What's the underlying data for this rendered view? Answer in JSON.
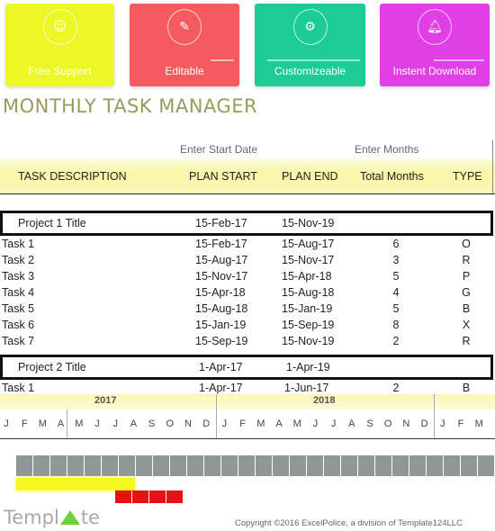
{
  "feature_cards": [
    {
      "label": "Free Support",
      "icon": "support-icon",
      "color": "#eef726"
    },
    {
      "label": "Editable",
      "icon": "edit-icon",
      "color": "#f55a5e"
    },
    {
      "label": "Customizeable",
      "icon": "gears-icon",
      "color": "#1ccb96"
    },
    {
      "label": "Instent Download",
      "icon": "bell-icon",
      "color": "#e13ee8"
    }
  ],
  "title": "MONTHLY TASK MANAGER",
  "hints": {
    "start_date": "Enter Start Date",
    "months": "Enter Months"
  },
  "columns": [
    "TASK DESCRIPTION",
    "PLAN START",
    "PLAN END",
    "Total Months",
    "TYPE"
  ],
  "projects": [
    {
      "title": "Project 1 Title",
      "start": "15-Feb-17",
      "end": "15-Nov-19",
      "tasks": [
        {
          "name": "Task 1",
          "start": "15-Feb-17",
          "end": "15-Aug-17",
          "months": "6",
          "type": "O"
        },
        {
          "name": "Task 2",
          "start": "15-Aug-17",
          "end": "15-Nov-17",
          "months": "3",
          "type": "R"
        },
        {
          "name": "Task 3",
          "start": "15-Nov-17",
          "end": "15-Apr-18",
          "months": "5",
          "type": "P"
        },
        {
          "name": "Task 4",
          "start": "15-Apr-18",
          "end": "15-Aug-18",
          "months": "4",
          "type": "G"
        },
        {
          "name": "Task 5",
          "start": "15-Aug-18",
          "end": "15-Jan-19",
          "months": "5",
          "type": "B"
        },
        {
          "name": "Task 6",
          "start": "15-Jan-19",
          "end": "15-Sep-19",
          "months": "8",
          "type": "X"
        },
        {
          "name": "Task 7",
          "start": "15-Sep-19",
          "end": "15-Nov-19",
          "months": "2",
          "type": "R"
        }
      ]
    },
    {
      "title": "Project 2 Title",
      "start": "1-Apr-17",
      "end": "1-Apr-19",
      "tasks": [
        {
          "name": "Task 1",
          "start": "1-Apr-17",
          "end": "1-Jun-17",
          "months": "2",
          "type": "B"
        }
      ]
    }
  ],
  "timeline": {
    "years": [
      "2017",
      "2018"
    ],
    "months": [
      "J",
      "F",
      "M",
      "A",
      "M",
      "J",
      "J",
      "A",
      "S",
      "O",
      "N",
      "D",
      "J",
      "F",
      "M",
      "A",
      "M",
      "J",
      "J",
      "A",
      "S",
      "O",
      "N",
      "D",
      "J",
      "F",
      "M"
    ],
    "grid_cells": 28,
    "bars": [
      {
        "color": "#f4f722",
        "start_index": 0,
        "length": 7
      },
      {
        "color": "#e81010",
        "start_index": 6,
        "length": 4
      }
    ]
  },
  "footer": {
    "logo_left": "Templ",
    "logo_right": "te",
    "copyright": "Copyright ©2016 ExcelPolice, a division of Template124LLC"
  }
}
